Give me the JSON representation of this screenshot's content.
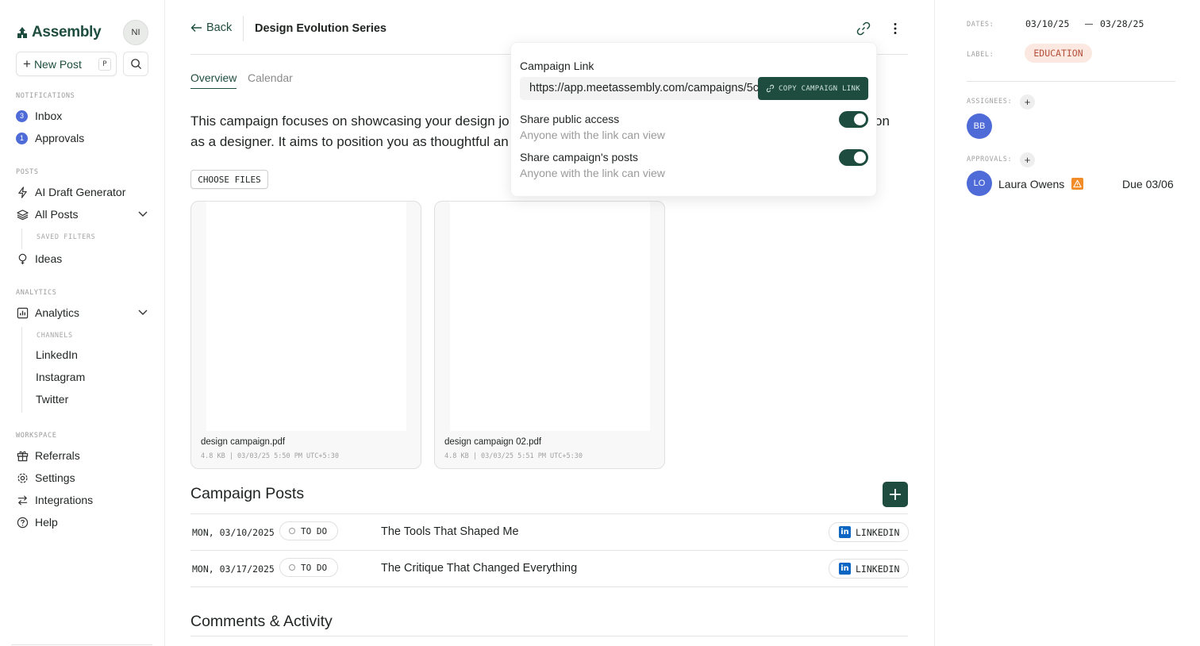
{
  "app": {
    "name": "Assembly",
    "user_initials": "NI"
  },
  "sidebar": {
    "new_post_label": "New Post",
    "new_post_shortcut": "P",
    "sections": {
      "notifications": "NOTIFICATIONS",
      "posts": "POSTS",
      "analytics": "ANALYTICS",
      "workspace": "WORKSPACE"
    },
    "inbox": {
      "label": "Inbox",
      "count": "3"
    },
    "approvals": {
      "label": "Approvals",
      "count": "1"
    },
    "ai_draft": "AI Draft Generator",
    "all_posts": "All Posts",
    "saved_filters": "SAVED FILTERS",
    "ideas": "Ideas",
    "analytics": "Analytics",
    "channels_label": "CHANNELS",
    "channels": [
      "LinkedIn",
      "Instagram",
      "Twitter"
    ],
    "referrals": "Referrals",
    "settings": "Settings",
    "integrations": "Integrations",
    "help": "Help"
  },
  "header": {
    "back_label": "Back",
    "title": "Design Evolution Series"
  },
  "tabs": {
    "overview": "Overview",
    "calendar": "Calendar"
  },
  "description": {
    "line1": "This campaign focuses on showcasing your design jo",
    "line1_tail": "on",
    "line2": "as a designer. It aims to position you as thoughtful an"
  },
  "choose_files_label": "CHOOSE FILES",
  "files": [
    {
      "name": "design campaign.pdf",
      "meta": "4.8 KB | 03/03/25 5:50 PM UTC+5:30"
    },
    {
      "name": "design campaign 02.pdf",
      "meta": "4.8 KB | 03/03/25 5:51 PM UTC+5:30"
    }
  ],
  "campaign_posts": {
    "title": "Campaign Posts",
    "rows": [
      {
        "date": "MON, 03/10/2025",
        "status": "TO DO",
        "title": "The Tools That Shaped Me",
        "channel": "LINKEDIN"
      },
      {
        "date": "MON, 03/17/2025",
        "status": "TO DO",
        "title": "The Critique That Changed Everything",
        "channel": "LINKEDIN"
      }
    ]
  },
  "comments_title": "Comments & Activity",
  "popover": {
    "title": "Campaign Link",
    "url": "https://app.meetassembly.com/campaigns/5c",
    "copy_label": "COPY CAMPAIGN LINK",
    "share_public": {
      "title": "Share public access",
      "subtitle": "Anyone with the link can view",
      "enabled": true
    },
    "share_posts": {
      "title": "Share campaign's posts",
      "subtitle": "Anyone with the link can view",
      "enabled": true
    }
  },
  "details": {
    "dates_label": "DATES:",
    "start_date": "03/10/25",
    "end_date": "03/28/25",
    "label_label": "LABEL:",
    "label_value": "EDUCATION",
    "assignees_label": "ASSIGNEES:",
    "assignee_initials": "BB",
    "approvals_label": "APPROVALS:",
    "approver_initials": "LO",
    "approver_name": "Laura Owens",
    "approver_due": "Due 03/06"
  },
  "colors": {
    "brand": "#1e4d3f",
    "badge": "#4f6bd8",
    "label_bg": "#fbe9e1",
    "label_text": "#b5503a",
    "warning": "#f28c28",
    "linkedin": "#0a66c2"
  }
}
